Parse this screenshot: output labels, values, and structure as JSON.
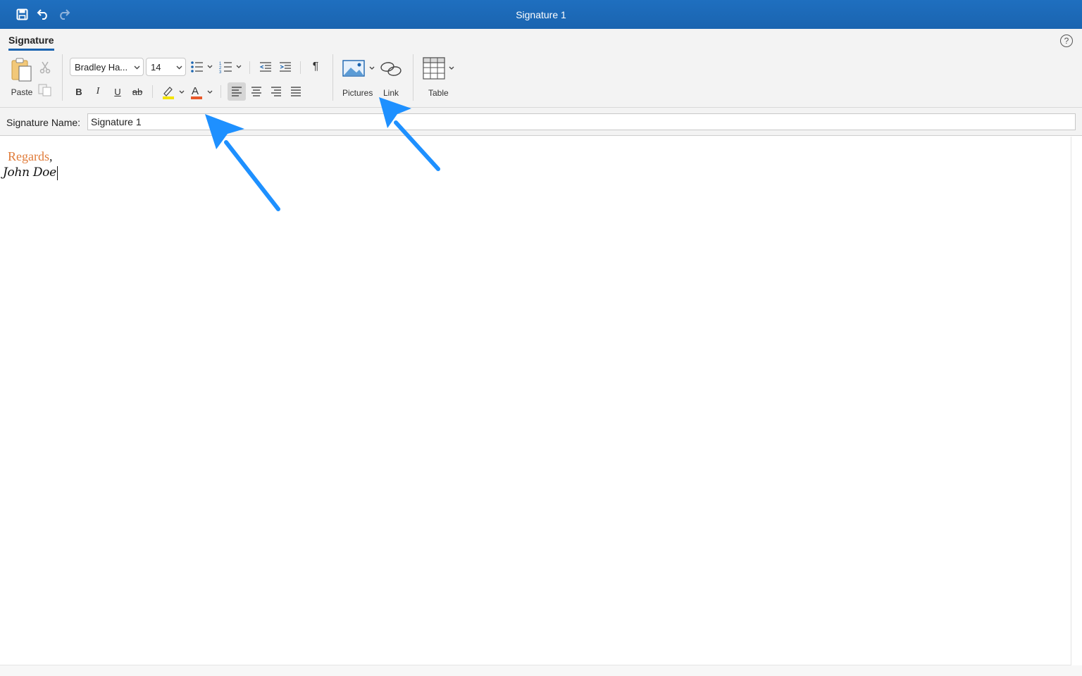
{
  "window": {
    "title": "Signature 1"
  },
  "ribbon": {
    "tab_label": "Signature",
    "help_glyph": "?",
    "paste_label": "Paste",
    "font_name": "Bradley Ha...",
    "font_size": "14",
    "bold": "B",
    "italic": "I",
    "underline": "U",
    "strike": "ab",
    "font_color_glyph": "A",
    "paragraph_glyph": "¶",
    "pictures_label": "Pictures",
    "link_label": "Link",
    "table_label": "Table"
  },
  "signature_name": {
    "label": "Signature Name:",
    "value": "Signature 1"
  },
  "editor": {
    "line1": "Regards",
    "line1_comma": ",",
    "line2": "John Doe"
  },
  "colors": {
    "titlebar": "#1a64b0",
    "accent": "#1a64b0",
    "regards": "#e07b39",
    "highlight": "#f4e400",
    "font_color": "#e8592a",
    "arrow": "#1e90ff"
  }
}
